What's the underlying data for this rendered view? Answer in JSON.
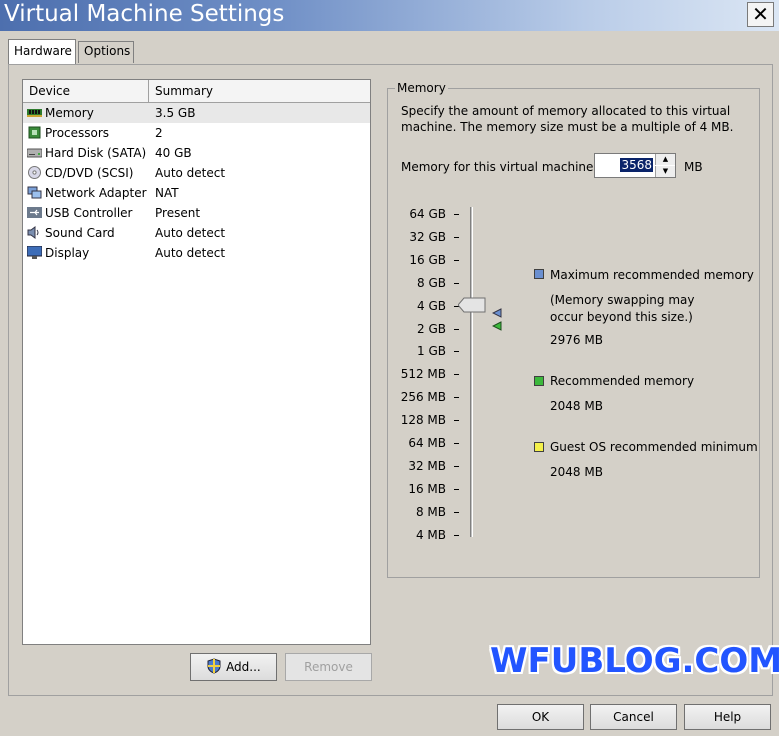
{
  "window": {
    "title": "Virtual Machine Settings",
    "close_label": "✕"
  },
  "tabs": [
    {
      "label": "Hardware",
      "active": true
    },
    {
      "label": "Options",
      "active": false
    }
  ],
  "device_list": {
    "columns": [
      "Device",
      "Summary"
    ],
    "rows": [
      {
        "icon": "memory-icon",
        "name": "Memory",
        "summary": "3.5 GB",
        "selected": true
      },
      {
        "icon": "processor-icon",
        "name": "Processors",
        "summary": "2"
      },
      {
        "icon": "hard-disk-icon",
        "name": "Hard Disk (SATA)",
        "summary": "40 GB"
      },
      {
        "icon": "cd-dvd-icon",
        "name": "CD/DVD (SCSI)",
        "summary": "Auto detect"
      },
      {
        "icon": "network-adapter-icon",
        "name": "Network Adapter",
        "summary": "NAT"
      },
      {
        "icon": "usb-icon",
        "name": "USB Controller",
        "summary": "Present"
      },
      {
        "icon": "sound-icon",
        "name": "Sound Card",
        "summary": "Auto detect"
      },
      {
        "icon": "display-icon",
        "name": "Display",
        "summary": "Auto detect"
      }
    ]
  },
  "buttons": {
    "add": "Add...",
    "remove": "Remove",
    "ok": "OK",
    "cancel": "Cancel",
    "help": "Help"
  },
  "memory": {
    "group_label": "Memory",
    "description": "Specify the amount of memory allocated to this virtual machine. The memory size must be a multiple of 4 MB.",
    "field_label": "Memory for this virtual machine:",
    "value": "3568",
    "unit": "MB",
    "scale": [
      "64 GB",
      "32 GB",
      "16 GB",
      "8 GB",
      "4 GB",
      "2 GB",
      "1 GB",
      "512 MB",
      "256 MB",
      "128 MB",
      "64 MB",
      "32 MB",
      "16 MB",
      "8 MB",
      "4 MB"
    ],
    "legend": [
      {
        "label": "Maximum recommended memory",
        "note": "(Memory swapping may occur beyond this size.)",
        "value": "2976 MB",
        "color": "#6a8fd0"
      },
      {
        "label": "Recommended memory",
        "value": "2048 MB",
        "color": "#3cb83c"
      },
      {
        "label": "Guest OS recommended minimum",
        "value": "2048 MB",
        "color": "#f4f04a"
      }
    ]
  },
  "watermark": "WFUBLOG.COM"
}
